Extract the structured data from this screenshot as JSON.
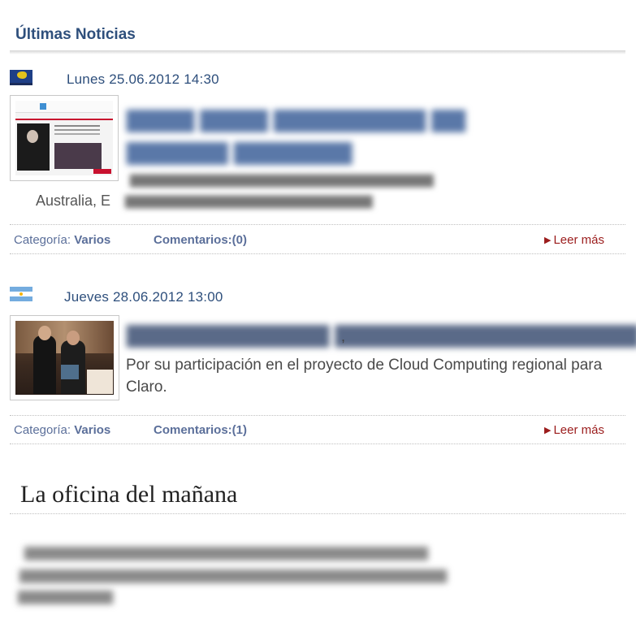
{
  "latest_news": {
    "title": "Últimas Noticias",
    "items": [
      {
        "flag": "australia-flag-icon",
        "date": "Lunes 25.06.2012 14:30",
        "headline_line1": "",
        "headline_line2": "",
        "summary_visible": "Australia, E",
        "summary_line1": "",
        "summary_line2": "",
        "category_label": "Categoría:",
        "category_value": "Varios",
        "comments": "Comentarios:(0)",
        "read_more": "Leer más"
      },
      {
        "flag": "argentina-flag-icon",
        "date": "Jueves 28.06.2012 13:00",
        "headline_line1": "",
        "headline_trailing": ",",
        "summary": "Por su participación en el proyecto de Cloud Computing regional para Claro.",
        "category_label": "Categoría:",
        "category_value": "Varios",
        "comments": "Comentarios:(1)",
        "read_more": "Leer más"
      }
    ]
  },
  "office_section": {
    "title": "La oficina del mañana",
    "paragraph_lines": []
  }
}
